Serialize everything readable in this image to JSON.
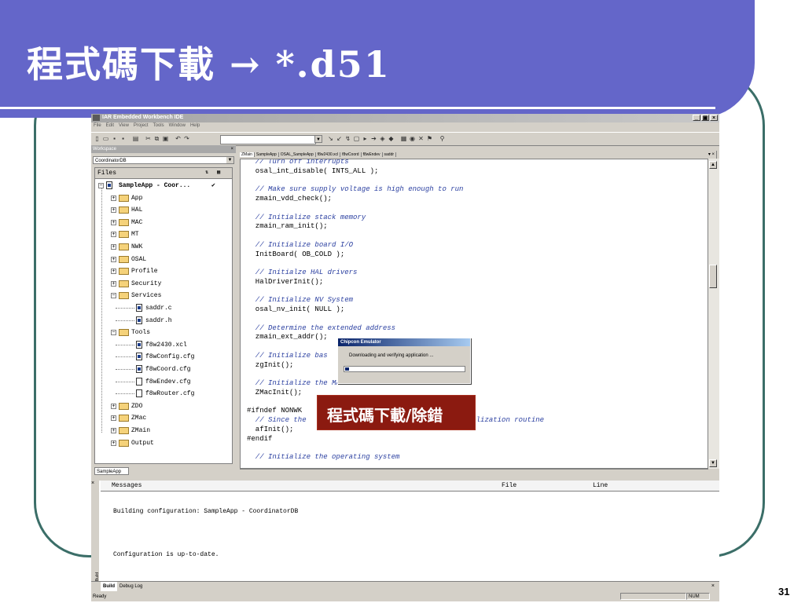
{
  "slide": {
    "title": "程式碼下載 → *.d51",
    "page_number": "31",
    "callout": "程式碼下載/除錯",
    "colors": {
      "banner": "#6466c9",
      "frame": "#3b6e68",
      "callout": "#8b1a10"
    }
  },
  "ide": {
    "window_title": "IAR Embedded Workbench IDE",
    "window_buttons": [
      "_",
      "▣",
      "×"
    ],
    "menu": [
      "File",
      "Edit",
      "View",
      "Project",
      "Tools",
      "Window",
      "Help"
    ],
    "workspace": {
      "header": "Workspace",
      "configuration": "CoordinatorDB",
      "columns": {
        "files": "Files"
      },
      "tab": "SampleApp",
      "tree": [
        {
          "label": "SampleApp - Coor...",
          "type": "project",
          "level": 0,
          "expanded": true,
          "checked": true
        },
        {
          "label": "App",
          "type": "folder",
          "level": 1
        },
        {
          "label": "HAL",
          "type": "folder",
          "level": 1
        },
        {
          "label": "MAC",
          "type": "folder",
          "level": 1
        },
        {
          "label": "MT",
          "type": "folder",
          "level": 1
        },
        {
          "label": "NWK",
          "type": "folder",
          "level": 1
        },
        {
          "label": "OSAL",
          "type": "folder",
          "level": 1
        },
        {
          "label": "Profile",
          "type": "folder",
          "level": 1
        },
        {
          "label": "Security",
          "type": "folder",
          "level": 1
        },
        {
          "label": "Services",
          "type": "folder",
          "level": 1,
          "expanded": true
        },
        {
          "label": "saddr.c",
          "type": "source",
          "level": 2
        },
        {
          "label": "saddr.h",
          "type": "source",
          "level": 2
        },
        {
          "label": "Tools",
          "type": "folder",
          "level": 1,
          "expanded": true
        },
        {
          "label": "f8w2430.xcl",
          "type": "source",
          "level": 2
        },
        {
          "label": "f8wConfig.cfg",
          "type": "source",
          "level": 2
        },
        {
          "label": "f8wCoord.cfg",
          "type": "source",
          "level": 2
        },
        {
          "label": "f8wEndev.cfg",
          "type": "file",
          "level": 2
        },
        {
          "label": "f8wRouter.cfg",
          "type": "file",
          "level": 2
        },
        {
          "label": "ZDO",
          "type": "folder",
          "level": 1
        },
        {
          "label": "ZMac",
          "type": "folder",
          "level": 1
        },
        {
          "label": "ZMain",
          "type": "folder",
          "level": 1
        },
        {
          "label": "Output",
          "type": "folder",
          "level": 1
        }
      ]
    },
    "editor": {
      "tabs": [
        "ZMain",
        "SampleApp",
        "OSAL_SampleApp",
        "f8w2430.xcl",
        "f8wCoord",
        "f8wEndev",
        "saddr"
      ],
      "active_tab": "ZMain",
      "lines": [
        {
          "text": "  // Turn off interrupts",
          "type": "comment"
        },
        {
          "text": "  osal_int_disable( INTS_ALL );",
          "type": "code"
        },
        {
          "text": "",
          "type": "code"
        },
        {
          "text": "  // Make sure supply voltage is high enough to run",
          "type": "comment"
        },
        {
          "text": "  zmain_vdd_check();",
          "type": "code"
        },
        {
          "text": "",
          "type": "code"
        },
        {
          "text": "  // Initialize stack memory",
          "type": "comment"
        },
        {
          "text": "  zmain_ram_init();",
          "type": "code"
        },
        {
          "text": "",
          "type": "code"
        },
        {
          "text": "  // Initialize board I/O",
          "type": "comment"
        },
        {
          "text": "  InitBoard( OB_COLD );",
          "type": "code"
        },
        {
          "text": "",
          "type": "code"
        },
        {
          "text": "  // Initialze HAL drivers",
          "type": "comment"
        },
        {
          "text": "  HalDriverInit();",
          "type": "code"
        },
        {
          "text": "",
          "type": "code"
        },
        {
          "text": "  // Initialize NV System",
          "type": "comment"
        },
        {
          "text": "  osal_nv_init( NULL );",
          "type": "code"
        },
        {
          "text": "",
          "type": "code"
        },
        {
          "text": "  // Determine the extended address",
          "type": "comment"
        },
        {
          "text": "  zmain_ext_addr();",
          "type": "code"
        },
        {
          "text": "",
          "type": "code"
        },
        {
          "text": "  // Initialize bas",
          "type": "comment"
        },
        {
          "text": "  zgInit();",
          "type": "code"
        },
        {
          "text": "",
          "type": "code"
        },
        {
          "text": "  // Initialize the MAC",
          "type": "comment"
        },
        {
          "text": "  ZMacInit();",
          "type": "code"
        },
        {
          "text": "",
          "type": "code"
        },
        {
          "text": "#ifndef NONWK",
          "type": "code"
        },
        {
          "text": "  // Since the                                       alization routine",
          "type": "comment"
        },
        {
          "text": "  afInit();",
          "type": "code"
        },
        {
          "text": "#endif",
          "type": "code"
        },
        {
          "text": "",
          "type": "code"
        },
        {
          "text": "  // Initialize the operating system",
          "type": "comment"
        }
      ]
    },
    "dialog": {
      "title": "Chipcon Emulator",
      "message": "Downloading and verifying application ...",
      "progress": 0.03
    },
    "messages": {
      "columns": [
        "Messages",
        "File",
        "Line"
      ],
      "lines": [
        "Building configuration: SampleApp - CoordinatorDB",
        "",
        "Configuration is up-to-date."
      ],
      "tabs": [
        "Build",
        "Debug Log"
      ],
      "side_label": "Build"
    },
    "status": {
      "left": "Ready",
      "num": "NUM"
    }
  }
}
